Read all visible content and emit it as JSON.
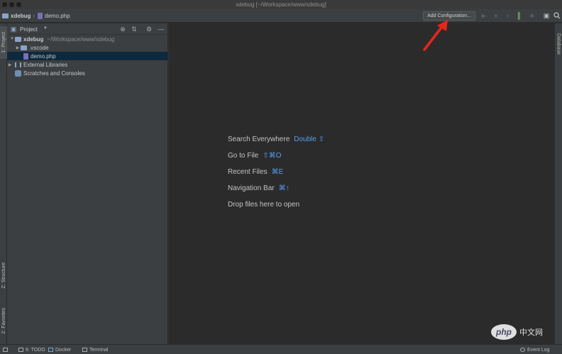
{
  "window": {
    "title": "xdebug [~/Workspace/www/xdebug]"
  },
  "navbar": {
    "project_name": "xdebug",
    "file_name": "demo.php",
    "add_configuration_label": "Add Configuration..."
  },
  "left_strip": {
    "project_tab": "1: Project",
    "structure_tab": "Z: Structure",
    "favorites_tab": "2: Favorites"
  },
  "project_panel": {
    "title": "Project",
    "tree": [
      {
        "label": "xdebug",
        "path": "~/Workspace/www/xdebug"
      },
      {
        "label": ".vscode"
      },
      {
        "label": "demo.php"
      },
      {
        "label": "External Libraries"
      },
      {
        "label": "Scratches and Consoles"
      }
    ]
  },
  "editor": {
    "hints": [
      {
        "label": "Search Everywhere",
        "key": "Double ⇧"
      },
      {
        "label": "Go to File",
        "key": "⇧⌘O"
      },
      {
        "label": "Recent Files",
        "key": "⌘E"
      },
      {
        "label": "Navigation Bar",
        "key": "⌘↑"
      },
      {
        "label": "Drop files here to open",
        "key": ""
      }
    ]
  },
  "right_strip": {
    "database_tab": "Database"
  },
  "bottom_bar": {
    "todo": "6: TODO",
    "docker": "Docker",
    "terminal": "Terminal",
    "event_log": "Event Log"
  },
  "watermark": {
    "text": "php",
    "cn_text": "中文网"
  },
  "colors": {
    "accent": "#589df6",
    "selection": "#0d293e",
    "annotation": "#e8261e"
  }
}
